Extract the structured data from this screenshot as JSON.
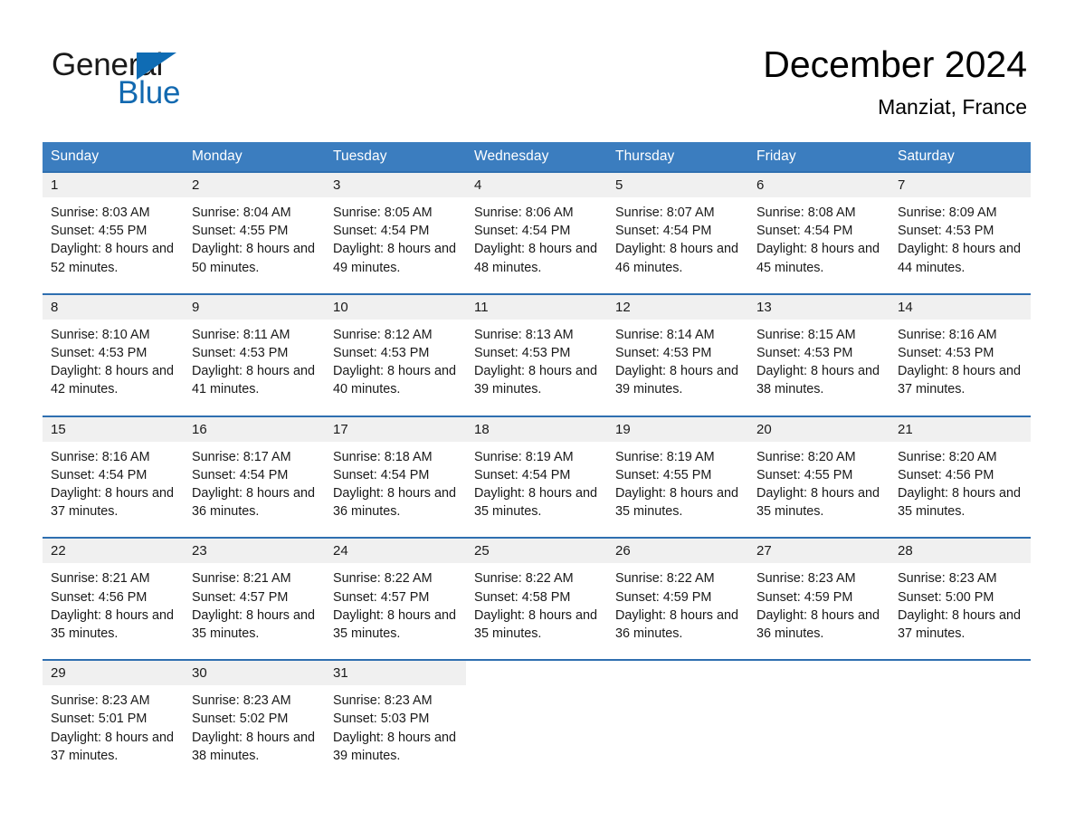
{
  "brand": {
    "name_top": "General",
    "name_bottom": "Blue",
    "triangle_color": "#0f6cb4",
    "blue_text_color": "#1269b0"
  },
  "header": {
    "title": "December 2024",
    "location": "Manziat, France"
  },
  "theme": {
    "header_blue": "#3b7dbf",
    "rule_blue": "#2f6fb0",
    "daynum_band": "#f0f0f0",
    "text": "#1a1a1a",
    "background": "#ffffff"
  },
  "calendar": {
    "weekday_headers": [
      "Sunday",
      "Monday",
      "Tuesday",
      "Wednesday",
      "Thursday",
      "Friday",
      "Saturday"
    ],
    "weeks": [
      [
        {
          "day": "1",
          "sunrise": "Sunrise: 8:03 AM",
          "sunset": "Sunset: 4:55 PM",
          "daylight": "Daylight: 8 hours and 52 minutes."
        },
        {
          "day": "2",
          "sunrise": "Sunrise: 8:04 AM",
          "sunset": "Sunset: 4:55 PM",
          "daylight": "Daylight: 8 hours and 50 minutes."
        },
        {
          "day": "3",
          "sunrise": "Sunrise: 8:05 AM",
          "sunset": "Sunset: 4:54 PM",
          "daylight": "Daylight: 8 hours and 49 minutes."
        },
        {
          "day": "4",
          "sunrise": "Sunrise: 8:06 AM",
          "sunset": "Sunset: 4:54 PM",
          "daylight": "Daylight: 8 hours and 48 minutes."
        },
        {
          "day": "5",
          "sunrise": "Sunrise: 8:07 AM",
          "sunset": "Sunset: 4:54 PM",
          "daylight": "Daylight: 8 hours and 46 minutes."
        },
        {
          "day": "6",
          "sunrise": "Sunrise: 8:08 AM",
          "sunset": "Sunset: 4:54 PM",
          "daylight": "Daylight: 8 hours and 45 minutes."
        },
        {
          "day": "7",
          "sunrise": "Sunrise: 8:09 AM",
          "sunset": "Sunset: 4:53 PM",
          "daylight": "Daylight: 8 hours and 44 minutes."
        }
      ],
      [
        {
          "day": "8",
          "sunrise": "Sunrise: 8:10 AM",
          "sunset": "Sunset: 4:53 PM",
          "daylight": "Daylight: 8 hours and 42 minutes."
        },
        {
          "day": "9",
          "sunrise": "Sunrise: 8:11 AM",
          "sunset": "Sunset: 4:53 PM",
          "daylight": "Daylight: 8 hours and 41 minutes."
        },
        {
          "day": "10",
          "sunrise": "Sunrise: 8:12 AM",
          "sunset": "Sunset: 4:53 PM",
          "daylight": "Daylight: 8 hours and 40 minutes."
        },
        {
          "day": "11",
          "sunrise": "Sunrise: 8:13 AM",
          "sunset": "Sunset: 4:53 PM",
          "daylight": "Daylight: 8 hours and 39 minutes."
        },
        {
          "day": "12",
          "sunrise": "Sunrise: 8:14 AM",
          "sunset": "Sunset: 4:53 PM",
          "daylight": "Daylight: 8 hours and 39 minutes."
        },
        {
          "day": "13",
          "sunrise": "Sunrise: 8:15 AM",
          "sunset": "Sunset: 4:53 PM",
          "daylight": "Daylight: 8 hours and 38 minutes."
        },
        {
          "day": "14",
          "sunrise": "Sunrise: 8:16 AM",
          "sunset": "Sunset: 4:53 PM",
          "daylight": "Daylight: 8 hours and 37 minutes."
        }
      ],
      [
        {
          "day": "15",
          "sunrise": "Sunrise: 8:16 AM",
          "sunset": "Sunset: 4:54 PM",
          "daylight": "Daylight: 8 hours and 37 minutes."
        },
        {
          "day": "16",
          "sunrise": "Sunrise: 8:17 AM",
          "sunset": "Sunset: 4:54 PM",
          "daylight": "Daylight: 8 hours and 36 minutes."
        },
        {
          "day": "17",
          "sunrise": "Sunrise: 8:18 AM",
          "sunset": "Sunset: 4:54 PM",
          "daylight": "Daylight: 8 hours and 36 minutes."
        },
        {
          "day": "18",
          "sunrise": "Sunrise: 8:19 AM",
          "sunset": "Sunset: 4:54 PM",
          "daylight": "Daylight: 8 hours and 35 minutes."
        },
        {
          "day": "19",
          "sunrise": "Sunrise: 8:19 AM",
          "sunset": "Sunset: 4:55 PM",
          "daylight": "Daylight: 8 hours and 35 minutes."
        },
        {
          "day": "20",
          "sunrise": "Sunrise: 8:20 AM",
          "sunset": "Sunset: 4:55 PM",
          "daylight": "Daylight: 8 hours and 35 minutes."
        },
        {
          "day": "21",
          "sunrise": "Sunrise: 8:20 AM",
          "sunset": "Sunset: 4:56 PM",
          "daylight": "Daylight: 8 hours and 35 minutes."
        }
      ],
      [
        {
          "day": "22",
          "sunrise": "Sunrise: 8:21 AM",
          "sunset": "Sunset: 4:56 PM",
          "daylight": "Daylight: 8 hours and 35 minutes."
        },
        {
          "day": "23",
          "sunrise": "Sunrise: 8:21 AM",
          "sunset": "Sunset: 4:57 PM",
          "daylight": "Daylight: 8 hours and 35 minutes."
        },
        {
          "day": "24",
          "sunrise": "Sunrise: 8:22 AM",
          "sunset": "Sunset: 4:57 PM",
          "daylight": "Daylight: 8 hours and 35 minutes."
        },
        {
          "day": "25",
          "sunrise": "Sunrise: 8:22 AM",
          "sunset": "Sunset: 4:58 PM",
          "daylight": "Daylight: 8 hours and 35 minutes."
        },
        {
          "day": "26",
          "sunrise": "Sunrise: 8:22 AM",
          "sunset": "Sunset: 4:59 PM",
          "daylight": "Daylight: 8 hours and 36 minutes."
        },
        {
          "day": "27",
          "sunrise": "Sunrise: 8:23 AM",
          "sunset": "Sunset: 4:59 PM",
          "daylight": "Daylight: 8 hours and 36 minutes."
        },
        {
          "day": "28",
          "sunrise": "Sunrise: 8:23 AM",
          "sunset": "Sunset: 5:00 PM",
          "daylight": "Daylight: 8 hours and 37 minutes."
        }
      ],
      [
        {
          "day": "29",
          "sunrise": "Sunrise: 8:23 AM",
          "sunset": "Sunset: 5:01 PM",
          "daylight": "Daylight: 8 hours and 37 minutes."
        },
        {
          "day": "30",
          "sunrise": "Sunrise: 8:23 AM",
          "sunset": "Sunset: 5:02 PM",
          "daylight": "Daylight: 8 hours and 38 minutes."
        },
        {
          "day": "31",
          "sunrise": "Sunrise: 8:23 AM",
          "sunset": "Sunset: 5:03 PM",
          "daylight": "Daylight: 8 hours and 39 minutes."
        },
        {
          "day": "",
          "sunrise": "",
          "sunset": "",
          "daylight": ""
        },
        {
          "day": "",
          "sunrise": "",
          "sunset": "",
          "daylight": ""
        },
        {
          "day": "",
          "sunrise": "",
          "sunset": "",
          "daylight": ""
        },
        {
          "day": "",
          "sunrise": "",
          "sunset": "",
          "daylight": ""
        }
      ]
    ]
  }
}
